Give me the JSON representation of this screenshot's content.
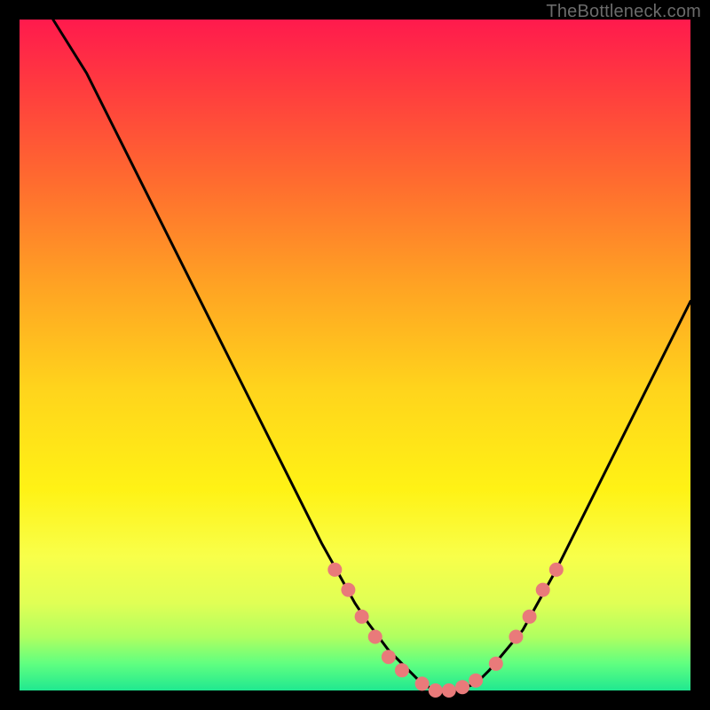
{
  "attribution": "TheBottleneck.com",
  "chart_data": {
    "type": "line",
    "title": "",
    "xlabel": "",
    "ylabel": "",
    "xlim": [
      0,
      100
    ],
    "ylim": [
      0,
      100
    ],
    "series": [
      {
        "name": "bottleneck-curve",
        "x": [
          5,
          10,
          15,
          20,
          25,
          30,
          35,
          40,
          45,
          50,
          52,
          55,
          58,
          60,
          62,
          65,
          68,
          70,
          75,
          80,
          85,
          90,
          95,
          100
        ],
        "y": [
          100,
          92,
          82,
          72,
          62,
          52,
          42,
          32,
          22,
          13,
          10,
          6,
          3,
          1,
          0,
          0,
          1,
          3,
          9,
          18,
          28,
          38,
          48,
          58
        ]
      }
    ],
    "highlight_points": {
      "name": "dotted-segments",
      "color": "#e97a7a",
      "points": [
        {
          "x": 47,
          "y": 18
        },
        {
          "x": 49,
          "y": 15
        },
        {
          "x": 51,
          "y": 11
        },
        {
          "x": 53,
          "y": 8
        },
        {
          "x": 55,
          "y": 5
        },
        {
          "x": 57,
          "y": 3
        },
        {
          "x": 60,
          "y": 1
        },
        {
          "x": 62,
          "y": 0
        },
        {
          "x": 64,
          "y": 0
        },
        {
          "x": 66,
          "y": 0.5
        },
        {
          "x": 68,
          "y": 1.5
        },
        {
          "x": 71,
          "y": 4
        },
        {
          "x": 74,
          "y": 8
        },
        {
          "x": 76,
          "y": 11
        },
        {
          "x": 78,
          "y": 15
        },
        {
          "x": 80,
          "y": 18
        }
      ]
    }
  }
}
